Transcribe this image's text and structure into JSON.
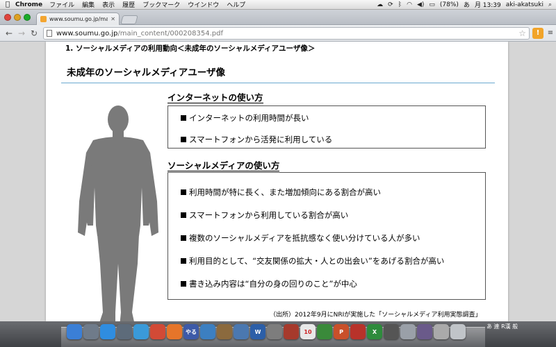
{
  "menubar": {
    "app_name": "Chrome",
    "items": [
      "ファイル",
      "編集",
      "表示",
      "履歴",
      "ブックマーク",
      "ウインドウ",
      "ヘルプ"
    ],
    "battery": "(78%)",
    "ime": "あ",
    "clock": "月 13:39",
    "user": "aki-akatsuki"
  },
  "browser": {
    "tab_title": "www.soumu.go.jp/main_c",
    "url_host": "www.soumu.go.jp",
    "url_path": "/main_content/000208354.pdf"
  },
  "slide": {
    "section_heading": "1. ソーシャルメディアの利用動向＜未成年のソーシャルメディアユーザ像＞",
    "title": "未成年のソーシャルメディアユーザ像",
    "internet_usage": {
      "label": "インターネットの使い方",
      "bullets": [
        "インターネットの利用時間が長い",
        "スマートフォンから活発に利用している"
      ]
    },
    "social_usage": {
      "label": "ソーシャルメディアの使い方",
      "bullets": [
        "利用時間が特に長く、また増加傾向にある割合が高い",
        "スマートフォンから利用している割合が高い",
        "複数のソーシャルメディアを抵抗感なく使い分けている人が多い",
        "利用目的として、“交友関係の拡大・人との出会い”をあげる割合が高い",
        "書き込み内容は“自分の身の回りのこと”が中心"
      ]
    },
    "source": "（出所）2012年9月にNRIが実施した「ソーシャルメディア利用実態調査」"
  },
  "dock": {
    "icons": [
      {
        "name": "finder",
        "color": "#3b7fd6",
        "label": ""
      },
      {
        "name": "app",
        "color": "#6f7b8a",
        "label": ""
      },
      {
        "name": "appstore",
        "color": "#2f8de0",
        "label": ""
      },
      {
        "name": "preview",
        "color": "#5d6b7a",
        "label": ""
      },
      {
        "name": "safari",
        "color": "#3a9ad9",
        "label": ""
      },
      {
        "name": "chrome",
        "color": "#d24a36",
        "label": ""
      },
      {
        "name": "firefox",
        "color": "#e6752a",
        "label": ""
      },
      {
        "name": "yaruki",
        "color": "#3d5aa8",
        "label": "やる"
      },
      {
        "name": "itunes",
        "color": "#3c7fc1",
        "label": ""
      },
      {
        "name": "app2",
        "color": "#8b6a3e",
        "label": ""
      },
      {
        "name": "app3",
        "color": "#4b78b0",
        "label": ""
      },
      {
        "name": "word",
        "color": "#2c5fa8",
        "label": "W"
      },
      {
        "name": "app4",
        "color": "#7d7d7d",
        "label": ""
      },
      {
        "name": "app5",
        "color": "#a63a2c",
        "label": ""
      },
      {
        "name": "calendar",
        "color": "#e8e8e8",
        "label": "10"
      },
      {
        "name": "app6",
        "color": "#3a8a3a",
        "label": ""
      },
      {
        "name": "powerpoint",
        "color": "#c9502a",
        "label": "P"
      },
      {
        "name": "app7",
        "color": "#b8322a",
        "label": ""
      },
      {
        "name": "excel",
        "color": "#2e8b3c",
        "label": "X"
      },
      {
        "name": "app8",
        "color": "#555",
        "label": ""
      },
      {
        "name": "app9",
        "color": "#9aa0a8",
        "label": ""
      },
      {
        "name": "app10",
        "color": "#6a5a8a",
        "label": ""
      },
      {
        "name": "app11",
        "color": "#aaa",
        "label": ""
      },
      {
        "name": "trash",
        "color": "#c0c4c8",
        "label": ""
      }
    ],
    "ime_status": "あ 連 R漢 般"
  }
}
